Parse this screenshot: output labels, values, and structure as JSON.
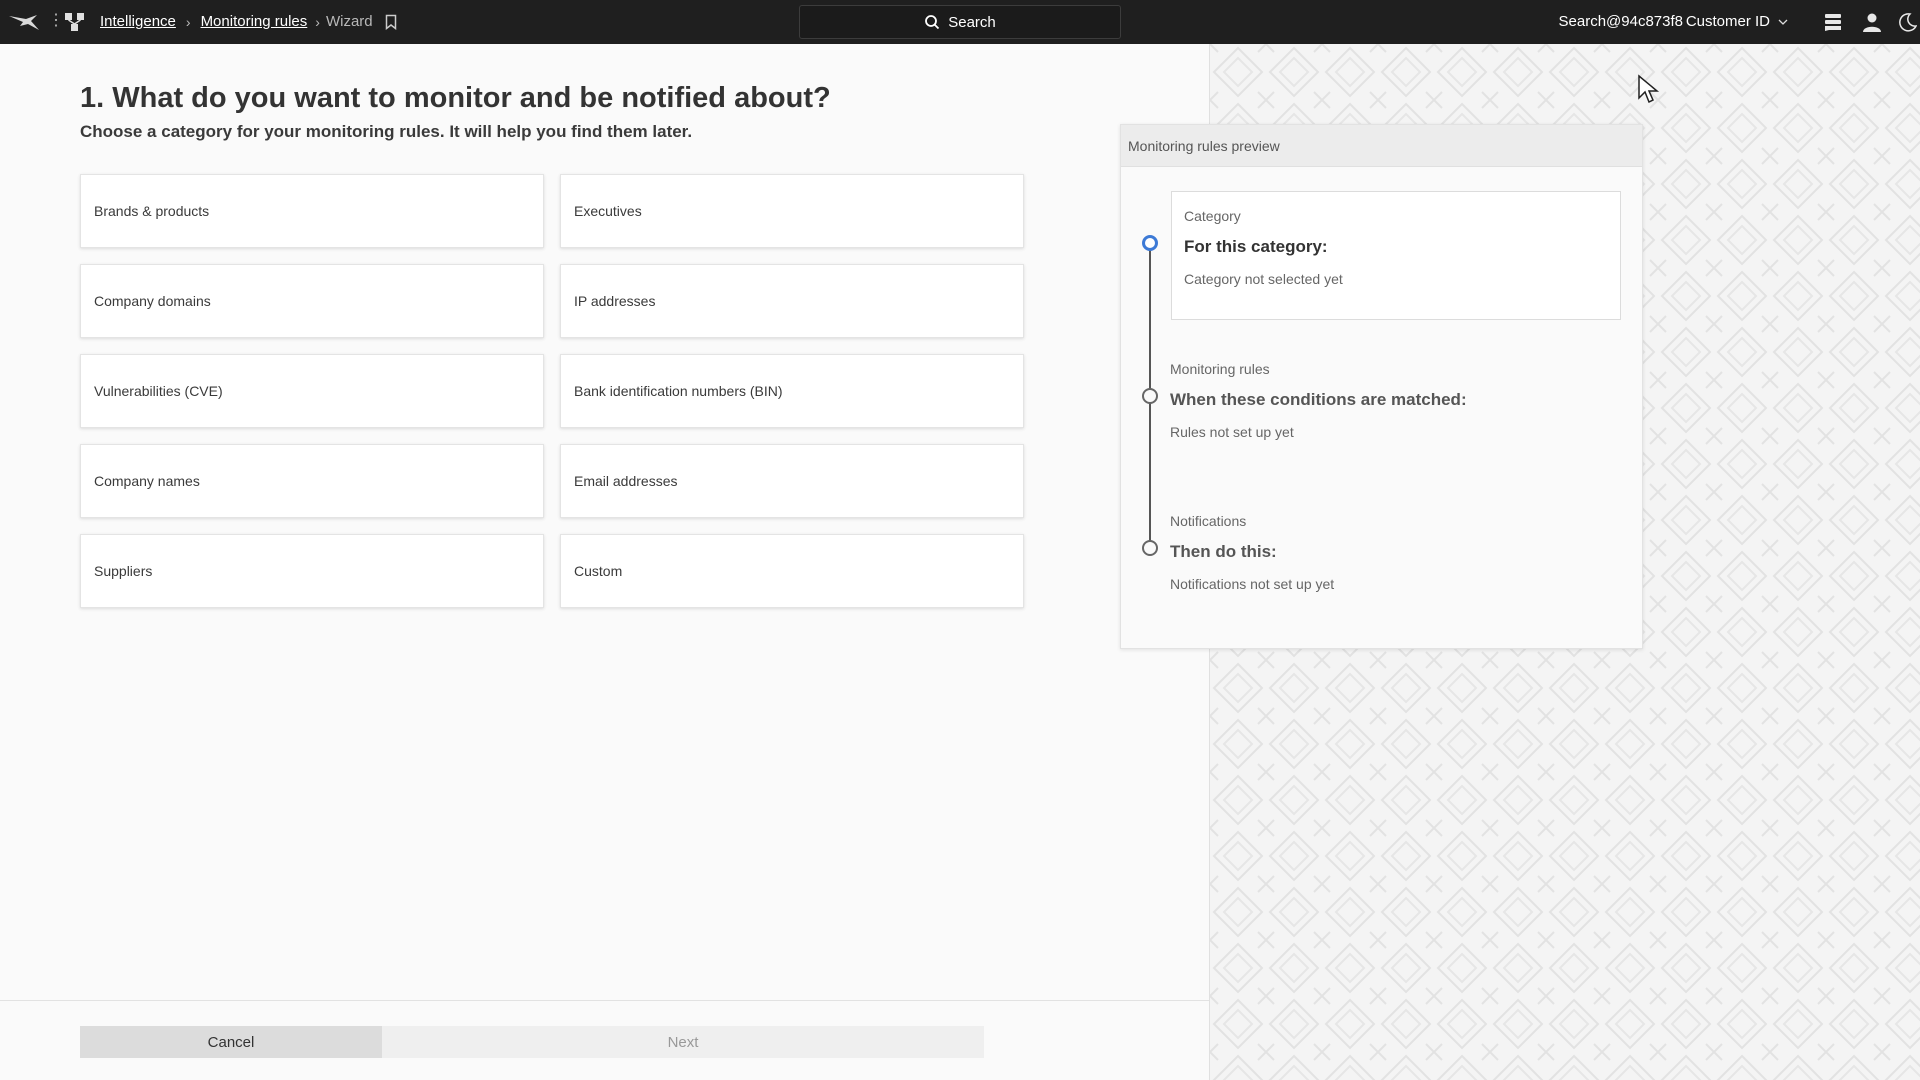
{
  "topbar": {
    "breadcrumbs": [
      "Intelligence",
      "Monitoring rules"
    ],
    "current_page": "Wizard",
    "search_label": "Search",
    "tenant": "Search@94c873f8",
    "customer_label": "Customer ID"
  },
  "page": {
    "title": "1. What do you want to monitor and be notified about?",
    "subtitle": "Choose a category for your monitoring rules. It will help you find them later."
  },
  "categories": [
    "Brands & products",
    "Executives",
    "Company domains",
    "IP addresses",
    "Vulnerabilities (CVE)",
    "Bank identification numbers (BIN)",
    "Company names",
    "Email addresses",
    "Suppliers",
    "Custom"
  ],
  "footer": {
    "cancel_label": "Cancel",
    "next_label": "Next"
  },
  "preview": {
    "header": "Monitoring rules preview",
    "steps": [
      {
        "label": "Category",
        "heading": "For this category:",
        "status": "Category not selected yet"
      },
      {
        "label": "Monitoring rules",
        "heading": "When these conditions are matched:",
        "status": "Rules not set up yet"
      },
      {
        "label": "Notifications",
        "heading": "Then do this:",
        "status": "Notifications not set up yet"
      }
    ]
  },
  "colors": {
    "topbar": "#1f1f1f",
    "accent": "#3d7ad6"
  }
}
